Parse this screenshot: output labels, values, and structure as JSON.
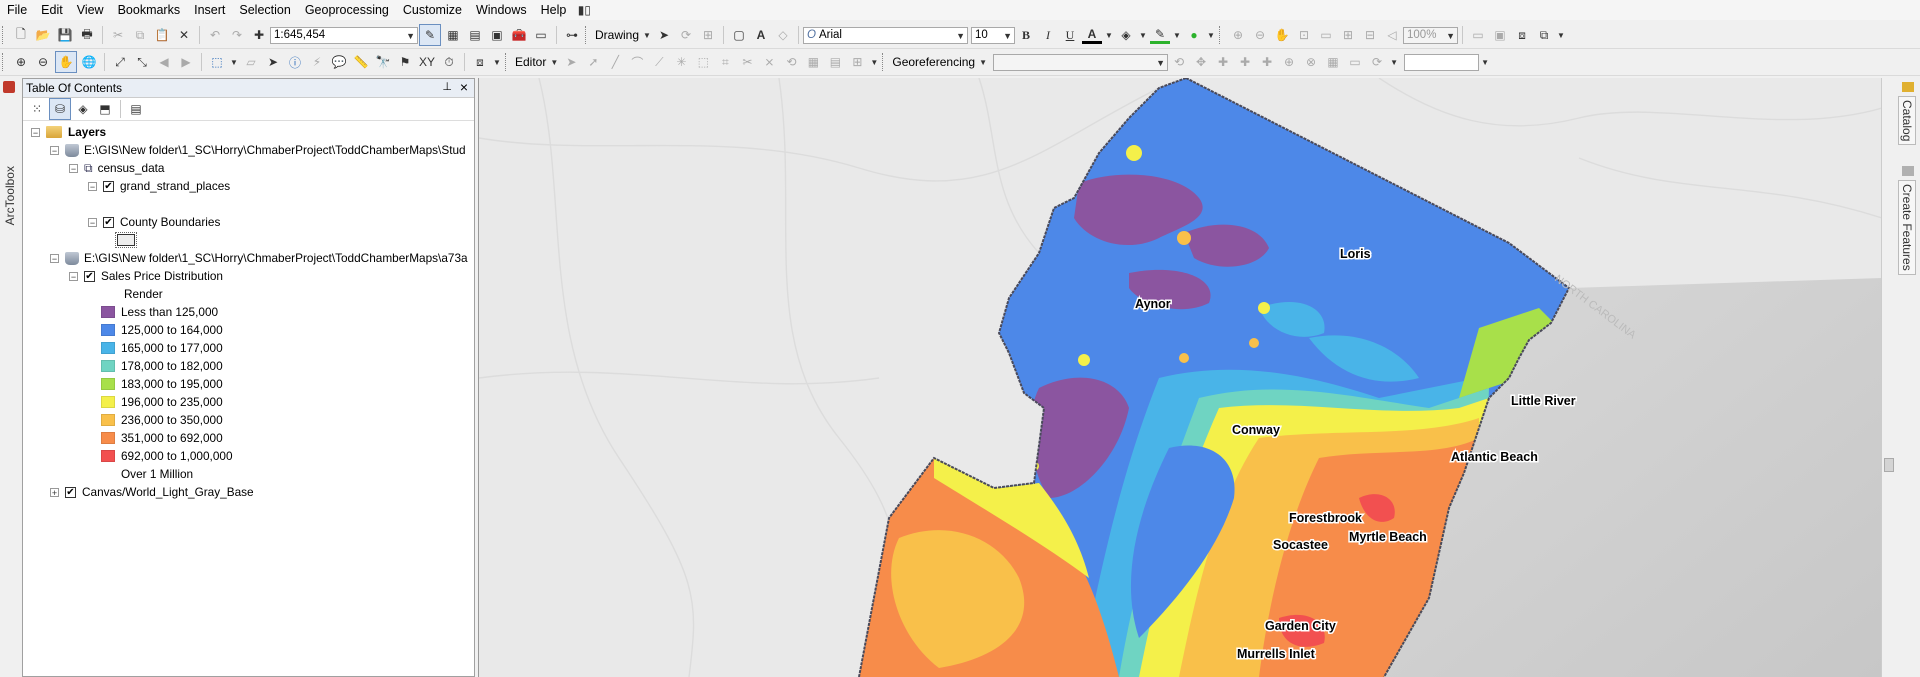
{
  "menu": [
    "File",
    "Edit",
    "View",
    "Bookmarks",
    "Insert",
    "Selection",
    "Geoprocessing",
    "Customize",
    "Windows",
    "Help"
  ],
  "toolbar": {
    "scale": "1:645,454",
    "drawing_label": "Drawing",
    "font_name": "Arial",
    "font_size": "10",
    "bold": "B",
    "italic": "I",
    "underline": "U",
    "font_color_label": "A",
    "zoom_percent": "100%",
    "editor_label": "Editor",
    "georef_label": "Georeferencing"
  },
  "side_tabs": {
    "left": "ArcToolbox",
    "right_top": "Catalog",
    "right_bottom": "Create Features"
  },
  "toc": {
    "title": "Table Of Contents",
    "layers_root": "Layers",
    "group1_path": "E:\\GIS\\New folder\\1_SC\\Horry\\ChmaberProject\\ToddChamberMaps\\Stud",
    "census_group": "census_data",
    "layer_places": "grand_strand_places",
    "layer_counties": "County Boundaries",
    "group2_path": "E:\\GIS\\New folder\\1_SC\\Horry\\ChmaberProject\\ToddChamberMaps\\a73a",
    "layer_sales": "Sales Price Distribution",
    "render_label": "Render",
    "legend": [
      {
        "label": "Less than 125,000",
        "color": "#8b55a0"
      },
      {
        "label": "125,000  to 164,000",
        "color": "#4d88e8"
      },
      {
        "label": "165,000  to 177,000",
        "color": "#49b4e8"
      },
      {
        "label": "178,000  to 182,000",
        "color": "#6fd4c2"
      },
      {
        "label": "183,000  to 195,000",
        "color": "#a8e04a"
      },
      {
        "label": "196,000  to 235,000",
        "color": "#f4f04a"
      },
      {
        "label": "236,000  to 350,000",
        "color": "#f9c04a"
      },
      {
        "label": "351,000  to 692,000",
        "color": "#f78c4a"
      },
      {
        "label": "692,000  to 1,000,000",
        "color": "#f25050"
      },
      {
        "label": "Over 1 Million",
        "color": ""
      }
    ],
    "basemap": "Canvas/World_Light_Gray_Base"
  },
  "map": {
    "cities": [
      "Loris",
      "Aynor",
      "Little River",
      "Conway",
      "Atlantic Beach",
      "Forestbrook",
      "Myrtle Beach",
      "Socastee",
      "Garden City",
      "Murrells Inlet"
    ],
    "boundary_label": "NORTH CAROLINA"
  }
}
